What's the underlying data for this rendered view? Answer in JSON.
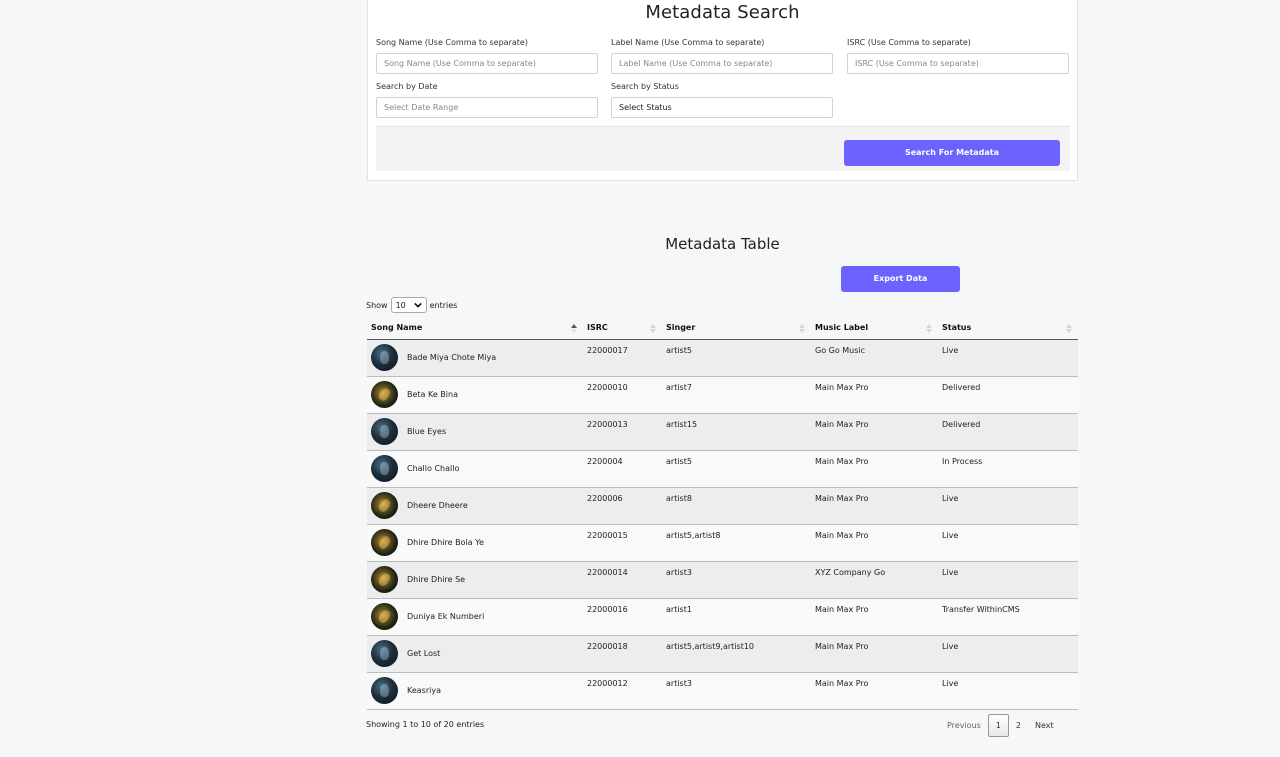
{
  "search": {
    "title": "Metadata Search",
    "song_name_label": "Song Name (Use Comma to separate)",
    "song_name_placeholder": "Song Name (Use Comma to separate)",
    "label_name_label": "Label Name (Use Comma to separate)",
    "label_name_placeholder": "Label Name (Use Comma to separate)",
    "isrc_label": "ISRC (Use Comma to separate)",
    "isrc_placeholder": "ISRC (Use Comma to separate)",
    "date_label": "Search by Date",
    "date_placeholder": "Select Date Range",
    "status_label": "Search by Status",
    "status_value": "Select Status",
    "button_label": "Search For Metadata"
  },
  "table": {
    "title": "Metadata Table",
    "export_label": "Export Data",
    "show_label": "Show",
    "entries_value": "10",
    "entries_label": "entries",
    "columns": [
      "Song Name",
      "ISRC",
      "Singer",
      "Music Label",
      "Status"
    ],
    "rows": [
      {
        "song": "Bade Miya Chote Miya",
        "isrc": "22000017",
        "singer": "artist5",
        "label": "Go Go Music",
        "status": "Live",
        "art": "blue"
      },
      {
        "song": "Beta Ke Bina",
        "isrc": "22000010",
        "singer": "artist7",
        "label": "Main Max Pro",
        "status": "Delivered",
        "art": "gold"
      },
      {
        "song": "Blue Eyes",
        "isrc": "22000013",
        "singer": "artist15",
        "label": "Main Max Pro",
        "status": "Delivered",
        "art": "blue"
      },
      {
        "song": "Challo Challo",
        "isrc": "2200004",
        "singer": "artist5",
        "label": "Main Max Pro",
        "status": "In Process",
        "art": "blue"
      },
      {
        "song": "Dheere Dheere",
        "isrc": "2200006",
        "singer": "artist8",
        "label": "Main Max Pro",
        "status": "Live",
        "art": "gold"
      },
      {
        "song": "Dhire Dhire Bola Ye",
        "isrc": "22000015",
        "singer": "artist5,artist8",
        "label": "Main Max Pro",
        "status": "Live",
        "art": "gold"
      },
      {
        "song": "Dhire Dhire Se",
        "isrc": "22000014",
        "singer": "artist3",
        "label": "XYZ Company Go",
        "status": "Live",
        "art": "gold"
      },
      {
        "song": "Duniya Ek Numberi",
        "isrc": "22000016",
        "singer": "artist1",
        "label": "Main Max Pro",
        "status": "Transfer WithinCMS",
        "art": "gold"
      },
      {
        "song": "Get Lost",
        "isrc": "22000018",
        "singer": "artist5,artist9,artist10",
        "label": "Main Max Pro",
        "status": "Live",
        "art": "blue"
      },
      {
        "song": "Keasriya",
        "isrc": "22000012",
        "singer": "artist3",
        "label": "Main Max Pro",
        "status": "Live",
        "art": "blue"
      }
    ],
    "info": "Showing 1 to 10 of 20 entries",
    "pagination": {
      "previous": "Previous",
      "pages": [
        "1",
        "2"
      ],
      "next": "Next",
      "current": "1"
    }
  },
  "colors": {
    "accent": "#6c63ff"
  }
}
